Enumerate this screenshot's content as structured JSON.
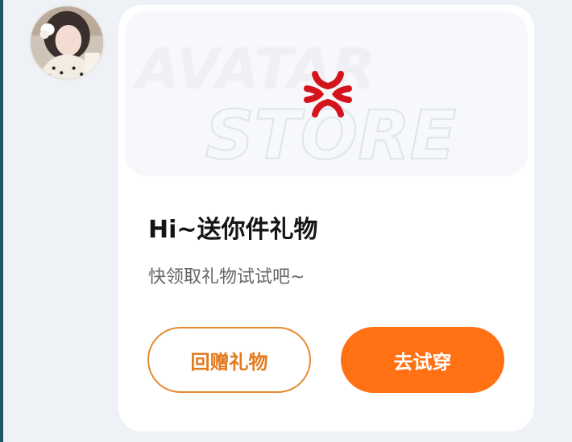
{
  "avatar": {
    "icon": "user-avatar-photo"
  },
  "banner": {
    "watermark_line1": "AVATAR",
    "watermark_line2": "STORE",
    "icon": "angry-vein-icon",
    "icon_color": "#d4141c"
  },
  "gift": {
    "title": "Hi~送你件礼物",
    "subtitle": "快领取礼物试试吧~"
  },
  "buttons": {
    "return_gift": "回赠礼物",
    "try_on": "去试穿"
  },
  "colors": {
    "accent": "#ff7113",
    "outline_button": "#e8882f"
  }
}
